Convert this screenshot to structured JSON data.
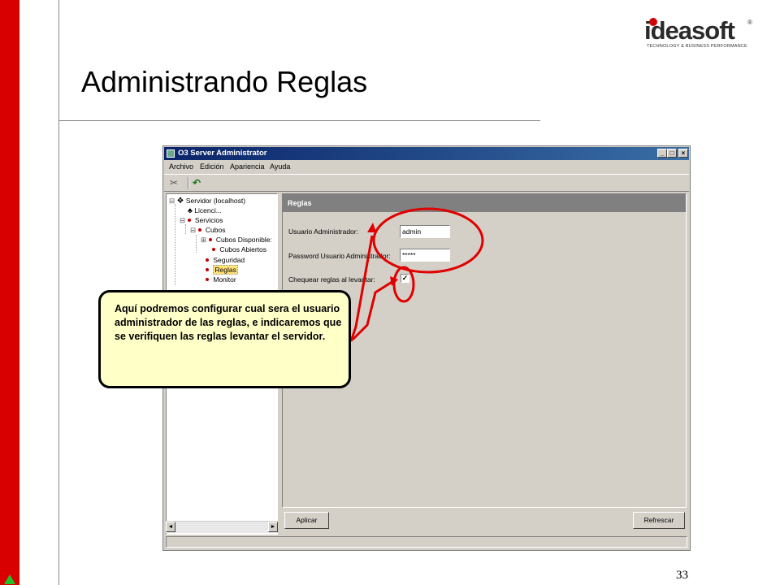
{
  "slide": {
    "title": "Administrando Reglas",
    "page_number": "33"
  },
  "logo": {
    "word": "ideasoft",
    "registered": "®",
    "tagline": "TECHNOLOGY & BUSINESS PERFORMANCE"
  },
  "window": {
    "title": "O3 Server Administrator",
    "buttons": {
      "minimize": "_",
      "maximize": "□",
      "close": "×"
    },
    "menu": [
      "Archivo",
      "Edición",
      "Apariencia",
      "Ayuda"
    ],
    "toolbar": {
      "cut_icon": "✂",
      "undo_icon": "↶"
    },
    "tree": {
      "items": [
        {
          "label": "Servidor (localhost)",
          "expander": "⊟"
        },
        {
          "label": "Licenci..."
        },
        {
          "label": "Servicios",
          "expander": "⊟"
        },
        {
          "label": "Cubos",
          "expander": "⊟"
        },
        {
          "label": "Cubos Disponible:",
          "expander": "⊞"
        },
        {
          "label": "Cubos Abiertos"
        },
        {
          "label": "Seguridad"
        },
        {
          "label": "Reglas",
          "selected": true
        },
        {
          "label": "Monitor"
        }
      ],
      "scroll_left": "◄",
      "scroll_right": "►"
    },
    "panel": {
      "header": "Reglas",
      "usuario_label": "Usuario Administrador:",
      "usuario_value": "admin",
      "password_label": "Password Usuario Administrador:",
      "password_value": "*****",
      "chequear_label": "Chequear reglas al levantar:",
      "chequear_checked": true,
      "chequear_mark": "✓",
      "aplicar_label": "Aplicar",
      "refrescar_label": "Refrescar"
    }
  },
  "callout": {
    "text": "Aquí podremos configurar cual sera el usuario administrador de las reglas, e indicaremos que se verifiquen las reglas levantar el servidor."
  },
  "colors": {
    "side_bar": "#d80000",
    "accent_triangle": "#22c02a",
    "annotation": "#e00000",
    "callout_fill": "#ffffc8",
    "selection": "#ffe27a"
  }
}
